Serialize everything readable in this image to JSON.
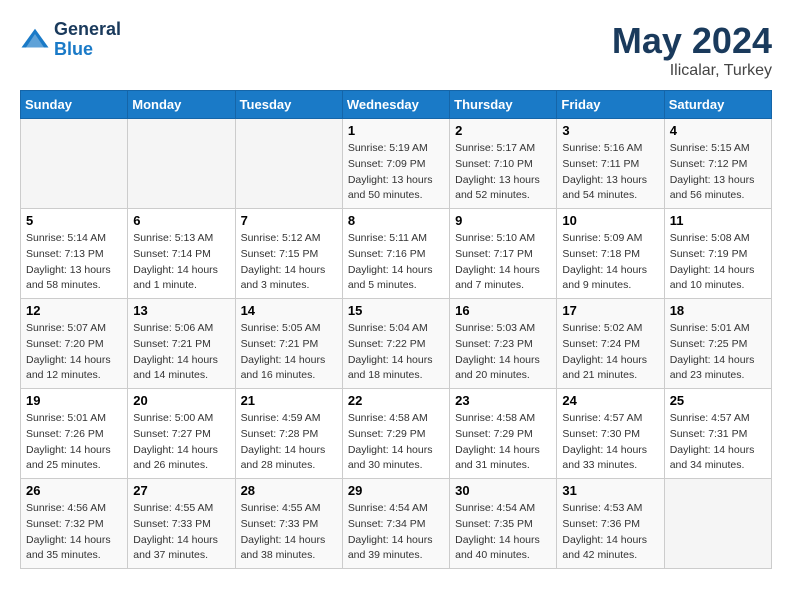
{
  "logo": {
    "line1": "General",
    "line2": "Blue"
  },
  "title": "May 2024",
  "location": "Ilicalar, Turkey",
  "days_of_week": [
    "Sunday",
    "Monday",
    "Tuesday",
    "Wednesday",
    "Thursday",
    "Friday",
    "Saturday"
  ],
  "weeks": [
    [
      {
        "day": "",
        "info": ""
      },
      {
        "day": "",
        "info": ""
      },
      {
        "day": "",
        "info": ""
      },
      {
        "day": "1",
        "sunrise": "Sunrise: 5:19 AM",
        "sunset": "Sunset: 7:09 PM",
        "daylight": "Daylight: 13 hours and 50 minutes."
      },
      {
        "day": "2",
        "sunrise": "Sunrise: 5:17 AM",
        "sunset": "Sunset: 7:10 PM",
        "daylight": "Daylight: 13 hours and 52 minutes."
      },
      {
        "day": "3",
        "sunrise": "Sunrise: 5:16 AM",
        "sunset": "Sunset: 7:11 PM",
        "daylight": "Daylight: 13 hours and 54 minutes."
      },
      {
        "day": "4",
        "sunrise": "Sunrise: 5:15 AM",
        "sunset": "Sunset: 7:12 PM",
        "daylight": "Daylight: 13 hours and 56 minutes."
      }
    ],
    [
      {
        "day": "5",
        "sunrise": "Sunrise: 5:14 AM",
        "sunset": "Sunset: 7:13 PM",
        "daylight": "Daylight: 13 hours and 58 minutes."
      },
      {
        "day": "6",
        "sunrise": "Sunrise: 5:13 AM",
        "sunset": "Sunset: 7:14 PM",
        "daylight": "Daylight: 14 hours and 1 minute."
      },
      {
        "day": "7",
        "sunrise": "Sunrise: 5:12 AM",
        "sunset": "Sunset: 7:15 PM",
        "daylight": "Daylight: 14 hours and 3 minutes."
      },
      {
        "day": "8",
        "sunrise": "Sunrise: 5:11 AM",
        "sunset": "Sunset: 7:16 PM",
        "daylight": "Daylight: 14 hours and 5 minutes."
      },
      {
        "day": "9",
        "sunrise": "Sunrise: 5:10 AM",
        "sunset": "Sunset: 7:17 PM",
        "daylight": "Daylight: 14 hours and 7 minutes."
      },
      {
        "day": "10",
        "sunrise": "Sunrise: 5:09 AM",
        "sunset": "Sunset: 7:18 PM",
        "daylight": "Daylight: 14 hours and 9 minutes."
      },
      {
        "day": "11",
        "sunrise": "Sunrise: 5:08 AM",
        "sunset": "Sunset: 7:19 PM",
        "daylight": "Daylight: 14 hours and 10 minutes."
      }
    ],
    [
      {
        "day": "12",
        "sunrise": "Sunrise: 5:07 AM",
        "sunset": "Sunset: 7:20 PM",
        "daylight": "Daylight: 14 hours and 12 minutes."
      },
      {
        "day": "13",
        "sunrise": "Sunrise: 5:06 AM",
        "sunset": "Sunset: 7:21 PM",
        "daylight": "Daylight: 14 hours and 14 minutes."
      },
      {
        "day": "14",
        "sunrise": "Sunrise: 5:05 AM",
        "sunset": "Sunset: 7:21 PM",
        "daylight": "Daylight: 14 hours and 16 minutes."
      },
      {
        "day": "15",
        "sunrise": "Sunrise: 5:04 AM",
        "sunset": "Sunset: 7:22 PM",
        "daylight": "Daylight: 14 hours and 18 minutes."
      },
      {
        "day": "16",
        "sunrise": "Sunrise: 5:03 AM",
        "sunset": "Sunset: 7:23 PM",
        "daylight": "Daylight: 14 hours and 20 minutes."
      },
      {
        "day": "17",
        "sunrise": "Sunrise: 5:02 AM",
        "sunset": "Sunset: 7:24 PM",
        "daylight": "Daylight: 14 hours and 21 minutes."
      },
      {
        "day": "18",
        "sunrise": "Sunrise: 5:01 AM",
        "sunset": "Sunset: 7:25 PM",
        "daylight": "Daylight: 14 hours and 23 minutes."
      }
    ],
    [
      {
        "day": "19",
        "sunrise": "Sunrise: 5:01 AM",
        "sunset": "Sunset: 7:26 PM",
        "daylight": "Daylight: 14 hours and 25 minutes."
      },
      {
        "day": "20",
        "sunrise": "Sunrise: 5:00 AM",
        "sunset": "Sunset: 7:27 PM",
        "daylight": "Daylight: 14 hours and 26 minutes."
      },
      {
        "day": "21",
        "sunrise": "Sunrise: 4:59 AM",
        "sunset": "Sunset: 7:28 PM",
        "daylight": "Daylight: 14 hours and 28 minutes."
      },
      {
        "day": "22",
        "sunrise": "Sunrise: 4:58 AM",
        "sunset": "Sunset: 7:29 PM",
        "daylight": "Daylight: 14 hours and 30 minutes."
      },
      {
        "day": "23",
        "sunrise": "Sunrise: 4:58 AM",
        "sunset": "Sunset: 7:29 PM",
        "daylight": "Daylight: 14 hours and 31 minutes."
      },
      {
        "day": "24",
        "sunrise": "Sunrise: 4:57 AM",
        "sunset": "Sunset: 7:30 PM",
        "daylight": "Daylight: 14 hours and 33 minutes."
      },
      {
        "day": "25",
        "sunrise": "Sunrise: 4:57 AM",
        "sunset": "Sunset: 7:31 PM",
        "daylight": "Daylight: 14 hours and 34 minutes."
      }
    ],
    [
      {
        "day": "26",
        "sunrise": "Sunrise: 4:56 AM",
        "sunset": "Sunset: 7:32 PM",
        "daylight": "Daylight: 14 hours and 35 minutes."
      },
      {
        "day": "27",
        "sunrise": "Sunrise: 4:55 AM",
        "sunset": "Sunset: 7:33 PM",
        "daylight": "Daylight: 14 hours and 37 minutes."
      },
      {
        "day": "28",
        "sunrise": "Sunrise: 4:55 AM",
        "sunset": "Sunset: 7:33 PM",
        "daylight": "Daylight: 14 hours and 38 minutes."
      },
      {
        "day": "29",
        "sunrise": "Sunrise: 4:54 AM",
        "sunset": "Sunset: 7:34 PM",
        "daylight": "Daylight: 14 hours and 39 minutes."
      },
      {
        "day": "30",
        "sunrise": "Sunrise: 4:54 AM",
        "sunset": "Sunset: 7:35 PM",
        "daylight": "Daylight: 14 hours and 40 minutes."
      },
      {
        "day": "31",
        "sunrise": "Sunrise: 4:53 AM",
        "sunset": "Sunset: 7:36 PM",
        "daylight": "Daylight: 14 hours and 42 minutes."
      },
      {
        "day": "",
        "info": ""
      }
    ]
  ]
}
